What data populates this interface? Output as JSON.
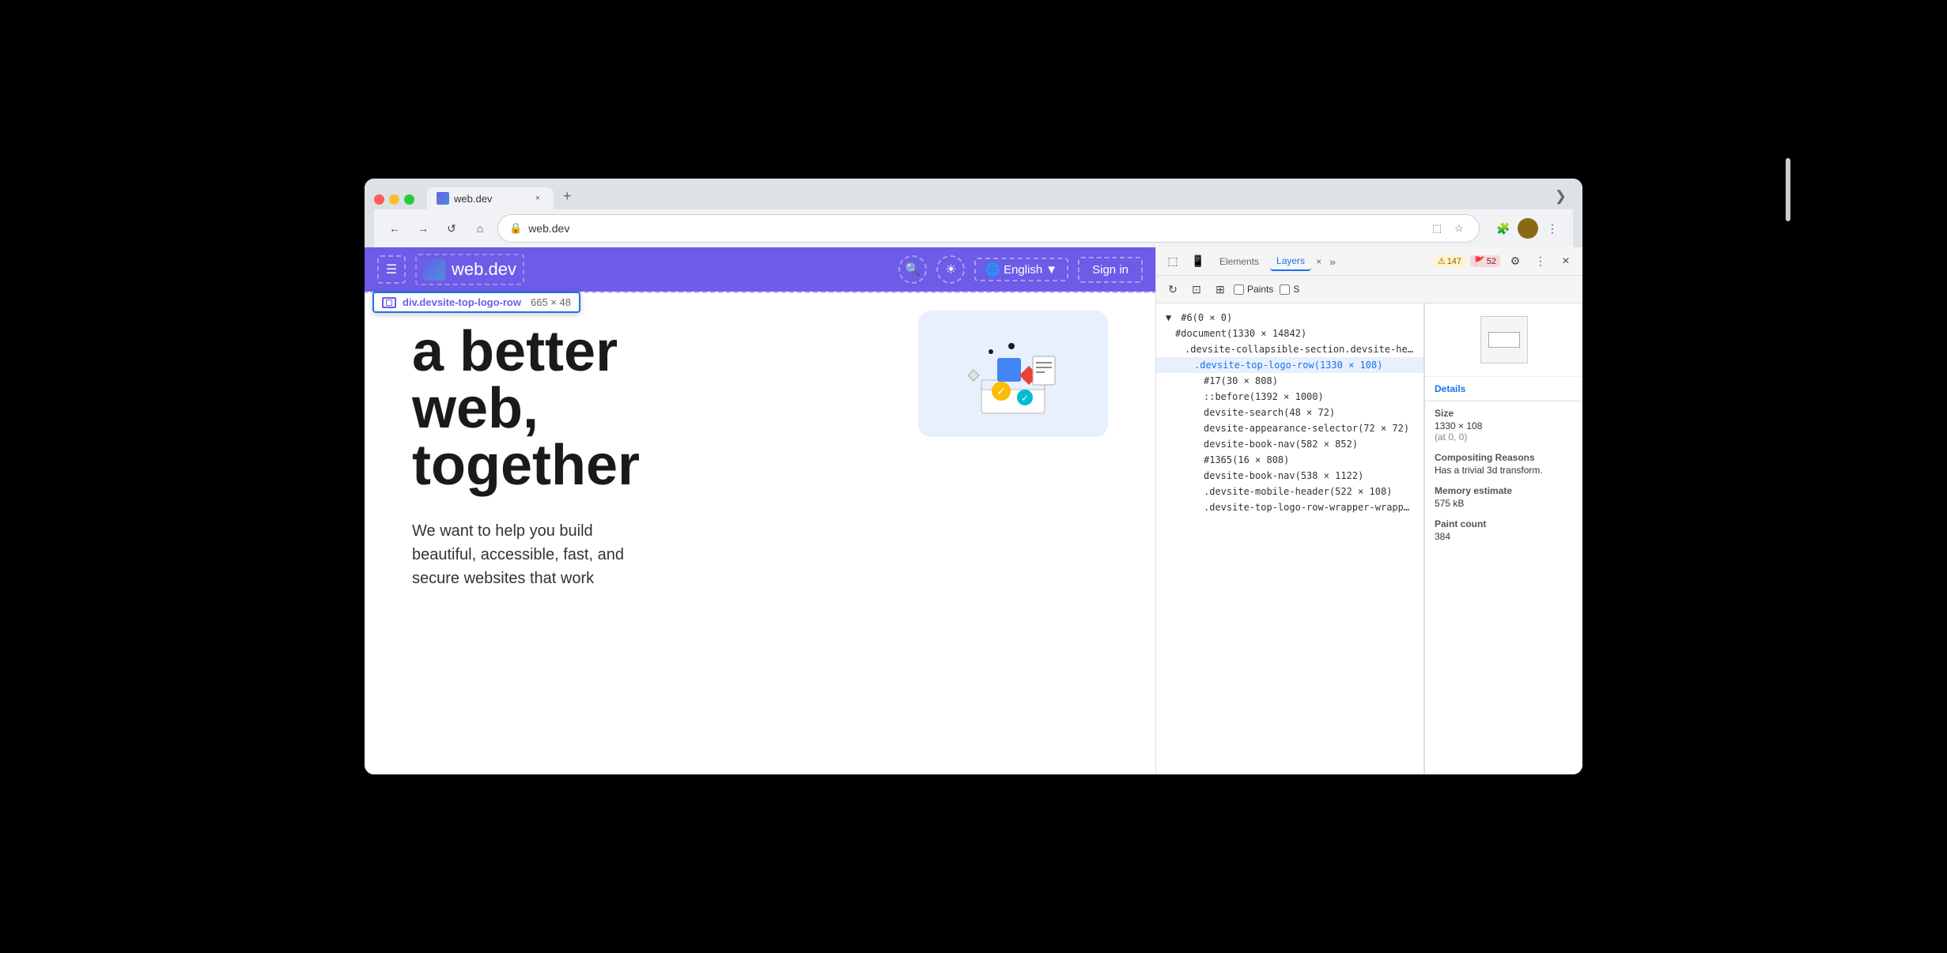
{
  "browser": {
    "tab_title": "web.dev",
    "tab_favicon": "webdev-favicon",
    "url": "web.dev",
    "new_tab_label": "+",
    "more_tabs_label": "❯"
  },
  "navbar": {
    "back_label": "←",
    "forward_label": "→",
    "reload_label": "↺",
    "home_label": "⌂",
    "url_icon": "🔒",
    "url_text": "web.dev",
    "bookmark_label": "☆",
    "extensions_label": "🧩",
    "profile_label": "👤",
    "more_label": "⋮"
  },
  "webpage": {
    "header": {
      "menu_label": "☰",
      "logo_text": "web.dev",
      "search_label": "🔍",
      "theme_label": "☀",
      "language_label": "English",
      "language_arrow": "▼",
      "signin_label": "Sign in"
    },
    "element_tooltip": {
      "element_name": "div.devsite-top-logo-row",
      "size": "665 × 48"
    },
    "heading_line1": "a better",
    "heading_line2": "web,",
    "heading_line3": "together",
    "subtext_line1": "We want to help you build",
    "subtext_line2": "beautiful, accessible, fast, and",
    "subtext_line3": "secure websites that work"
  },
  "devtools": {
    "toolbar": {
      "inspect_label": "⬚",
      "device_label": "📱",
      "elements_tab": "Elements",
      "layers_tab": "Layers",
      "layers_close": "×",
      "more_tabs_label": "»",
      "warning_count": "147",
      "error_count": "52",
      "settings_label": "⚙",
      "more_label": "⋮",
      "close_label": "×"
    },
    "second_toolbar": {
      "rotate_label": "↻",
      "pan_label": "☐",
      "zoom_label": "⊞",
      "paints_label": "Paints",
      "scroll_label": "S"
    },
    "layers_tree": {
      "items": [
        {
          "label": "#6(0 × 0)",
          "indent": 0,
          "has_arrow": true,
          "selected": false
        },
        {
          "label": "#document(1330 × 14842)",
          "indent": 1,
          "selected": false
        },
        {
          "label": ".devsite-collapsible-section.devsite-hea…",
          "indent": 2,
          "selected": false
        },
        {
          "label": ".devsite-top-logo-row(1330 × 108)",
          "indent": 3,
          "selected": true
        },
        {
          "label": "#17(30 × 808)",
          "indent": 4,
          "selected": false
        },
        {
          "label": "::before(1392 × 1000)",
          "indent": 4,
          "selected": false
        },
        {
          "label": "devsite-search(48 × 72)",
          "indent": 4,
          "selected": false
        },
        {
          "label": "devsite-appearance-selector(72 × 72)",
          "indent": 4,
          "selected": false
        },
        {
          "label": "devsite-book-nav(582 × 852)",
          "indent": 4,
          "selected": false
        },
        {
          "label": "#1365(16 × 808)",
          "indent": 4,
          "selected": false
        },
        {
          "label": "devsite-book-nav(538 × 1122)",
          "indent": 4,
          "selected": false
        },
        {
          "label": ".devsite-mobile-header(522 × 108)",
          "indent": 4,
          "selected": false
        },
        {
          "label": ".devsite-top-logo-row-wrapper-wrappe…",
          "indent": 4,
          "selected": false
        }
      ]
    },
    "details": {
      "header": "Details",
      "size_label": "Size",
      "size_value": "1330 × 108",
      "size_sub": "(at 0, 0)",
      "compositing_label": "Compositing Reasons",
      "compositing_value": "Has a trivial 3d transform.",
      "memory_label": "Memory estimate",
      "memory_value": "575 kB",
      "paint_count_label": "Paint count",
      "paint_count_value": "384"
    }
  }
}
